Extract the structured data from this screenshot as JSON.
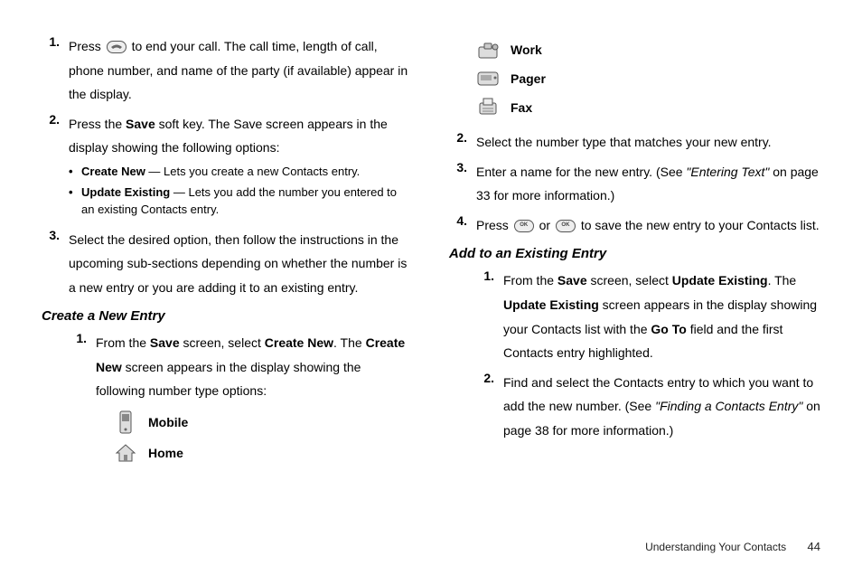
{
  "left": {
    "items": [
      {
        "num": "1.",
        "prefix": "Press ",
        "after_icon": " to end your call. The call time, length of call, phone number, and name of the party (if available) appear in the display."
      },
      {
        "num": "2.",
        "prefix": "Press the ",
        "bold1": "Save",
        "after": " soft key. The Save screen appears in the display showing the following options:",
        "bullets": [
          {
            "bold": "Create New",
            "rest": " — Lets you create a new Contacts entry."
          },
          {
            "bold": "Update Existing",
            "rest": " — Lets you add the number you entered to an existing Contacts entry."
          }
        ]
      },
      {
        "num": "3.",
        "text": "Select the desired option, then follow the instructions in the upcoming sub-sections depending on whether the number is a new entry or you are adding it to an existing entry."
      }
    ],
    "subheading": "Create a New Entry",
    "sub_items": [
      {
        "num": "1.",
        "p1": "From the ",
        "b1": "Save",
        "p2": " screen, select ",
        "b2": "Create New",
        "p3": ". The ",
        "b3": "Create New",
        "p4": " screen appears in the display showing the following number type options:"
      }
    ],
    "type_icons": [
      {
        "label": "Mobile"
      },
      {
        "label": "Home"
      }
    ]
  },
  "right": {
    "type_icons": [
      {
        "label": "Work"
      },
      {
        "label": "Pager"
      },
      {
        "label": "Fax"
      }
    ],
    "items_a": [
      {
        "num": "2.",
        "text": "Select the number type that matches your new entry."
      },
      {
        "num": "3.",
        "p1": "Enter a name for the new entry. (See ",
        "iq": "\"Entering Text\"",
        "p2": " on page 33 for more information.)"
      },
      {
        "num": "4.",
        "p1": "Press ",
        "p2": " or ",
        "p3": " to save the new entry to your Contacts list."
      }
    ],
    "subheading": "Add to an Existing Entry",
    "items_b": [
      {
        "num": "1.",
        "p1": "From the ",
        "b1": "Save",
        "p2": " screen, select ",
        "b2": "Update Existing",
        "p3": ". The ",
        "b3": "Update Existing",
        "p4": " screen appears in the display showing your Contacts list with the ",
        "b4": "Go To",
        "p5": " field and the first Contacts entry highlighted."
      },
      {
        "num": "2.",
        "p1": "Find and select the Contacts entry to which you want to add the new number. (See ",
        "iq": "\"Finding a Contacts Entry\"",
        "p2": " on page 38 for more information.)"
      }
    ]
  },
  "icon_inline": {
    "end_key": "⎋",
    "ok_small": "OK",
    "ok_large": "OK"
  },
  "footer": {
    "section": "Understanding Your Contacts",
    "page": "44"
  }
}
